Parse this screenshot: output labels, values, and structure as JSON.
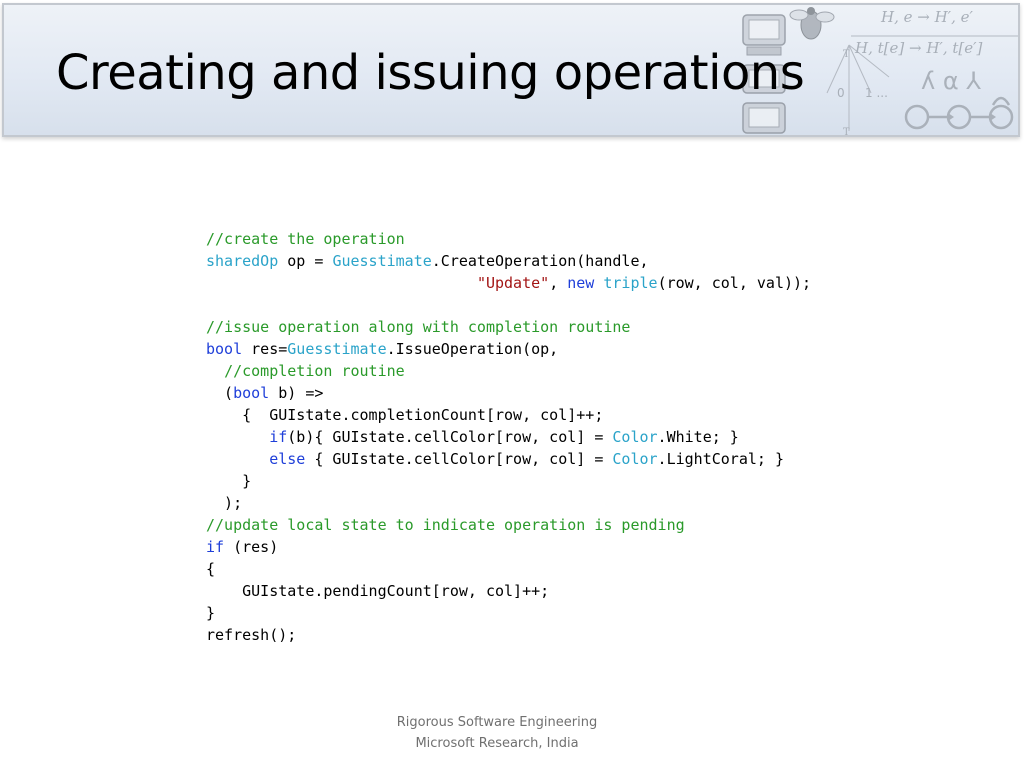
{
  "slide": {
    "title": "Creating and issuing operations",
    "footer": {
      "line1": "Rigorous Software Engineering",
      "line2": "Microsoft Research, India"
    }
  },
  "decoration": {
    "formula_top": "H, e  → H′, e′",
    "formula_bottom": "H, t[e]  → H′, t[e′]",
    "symbols": "ʎ α ⅄",
    "counter": "1 ..."
  },
  "code": {
    "l1": {
      "cm": "//create the operation"
    },
    "l2": {
      "ty1": "sharedOp",
      "t1": " op = ",
      "ty2": "Guesstimate",
      "t2": ".CreateOperation(handle,"
    },
    "l3": {
      "indent": "                              ",
      "st": "\"Update\"",
      "t1": ", ",
      "kw": "new",
      "t2": " ",
      "ty": "triple",
      "t3": "(row, col, val));"
    },
    "l4": {
      "blank": ""
    },
    "l5": {
      "cm": "//issue operation along with completion routine"
    },
    "l6": {
      "kw": "bool",
      "t1": " res=",
      "ty": "Guesstimate",
      "t2": ".IssueOperation(op,"
    },
    "l7": {
      "indent": "  ",
      "cm": "//completion routine"
    },
    "l8": {
      "t1": "  (",
      "kw": "bool",
      "t2": " b) =>"
    },
    "l9": {
      "t1": "    {  GUIstate.completionCount[row, col]++;"
    },
    "l10": {
      "indent": "       ",
      "kw": "if",
      "t1": "(b){ GUIstate.cellColor[row, col] = ",
      "ty": "Color",
      "t2": ".White; }"
    },
    "l11": {
      "indent": "       ",
      "kw": "else",
      "t1": " { GUIstate.cellColor[row, col] = ",
      "ty": "Color",
      "t2": ".LightCoral; }"
    },
    "l12": {
      "t1": "    }"
    },
    "l13": {
      "t1": "  );"
    },
    "l14": {
      "cm": "//update local state to indicate operation is pending"
    },
    "l15": {
      "kw": "if",
      "t1": " (res)"
    },
    "l16": {
      "t1": "{"
    },
    "l17": {
      "t1": "    GUIstate.pendingCount[row, col]++;"
    },
    "l18": {
      "t1": "}"
    },
    "l19": {
      "t1": "refresh();"
    }
  }
}
